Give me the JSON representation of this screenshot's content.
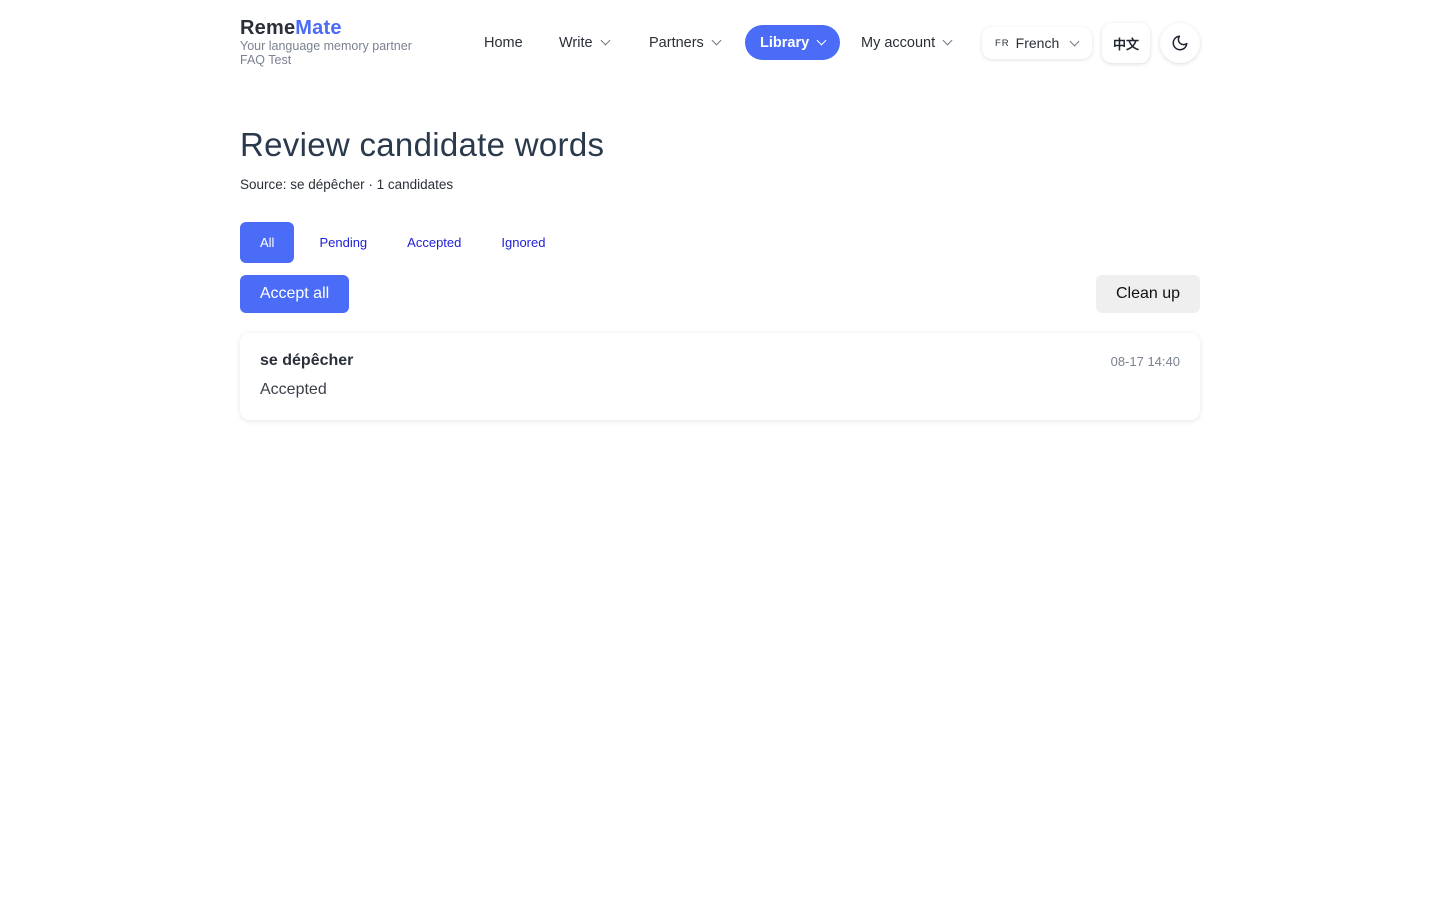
{
  "brand": {
    "name_part1": "Reme",
    "name_part2": "Mate",
    "tagline": "Your language memory partner",
    "user": "FAQ Test"
  },
  "nav": {
    "home": "Home",
    "write": "Write",
    "partners": "Partners",
    "library": "Library",
    "my_account": "My account",
    "active": "Library"
  },
  "language": {
    "code": "FR",
    "name": "French",
    "ui_language_label": "中文"
  },
  "icons": {
    "theme": "moon-icon",
    "dropdown": "chevron-down-icon"
  },
  "page": {
    "title": "Review candidate words",
    "subtitle": "Source: se dépêcher · 1 candidates"
  },
  "filters": {
    "all": "All",
    "pending": "Pending",
    "accepted": "Accepted",
    "ignored": "Ignored",
    "active": "All"
  },
  "actions": {
    "accept_all": "Accept all",
    "clean_up": "Clean up"
  },
  "candidates": [
    {
      "word": "se dépêcher",
      "status": "Accepted",
      "time": "08-17 14:40"
    }
  ],
  "colors": {
    "accent": "#4a6cf7",
    "link": "#1c1fd6"
  }
}
